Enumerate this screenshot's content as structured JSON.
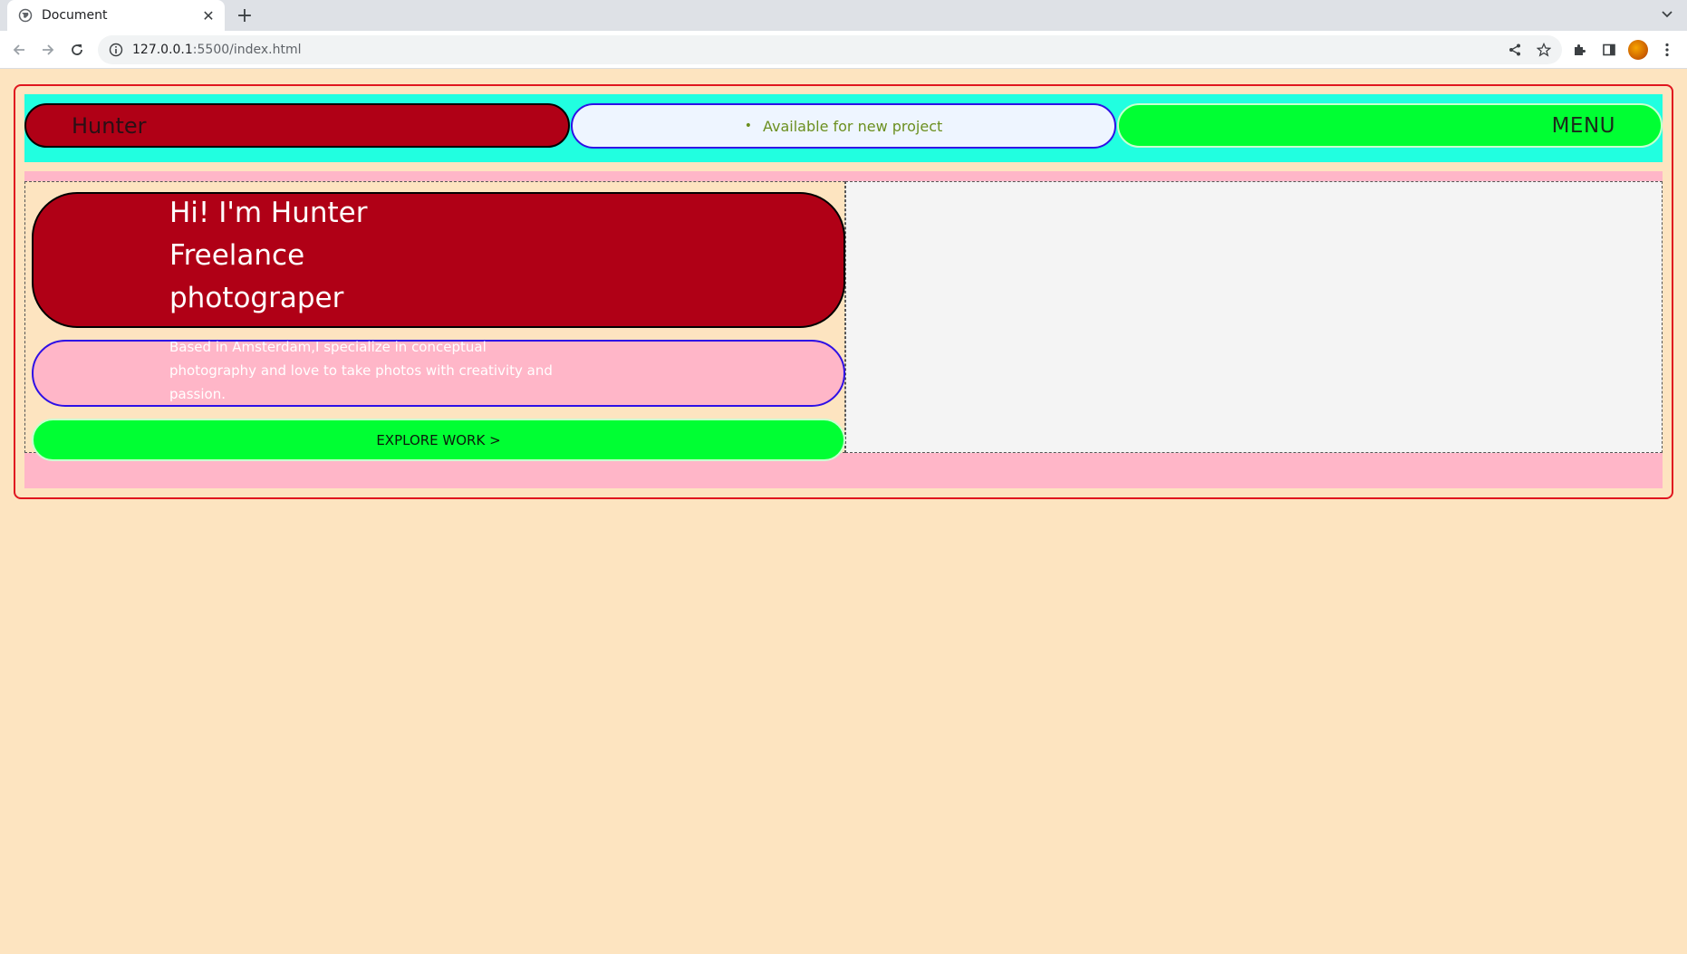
{
  "browser": {
    "tab_title": "Document",
    "tab_close": "✕",
    "new_tab": "+",
    "url_host": "127.0.0.1",
    "url_path": ":5500/index.html"
  },
  "header": {
    "logo": "Hunter",
    "availability": "Available for new project",
    "availability_bullet": "•",
    "menu": "MENU"
  },
  "hero": {
    "title": "Hi! I'm Hunter Freelance photograper",
    "description": "Based in Amsterdam,I specialize in conceptual photography and love to take photos with creativity and passion.",
    "cta": "EXPLORE WORK >"
  },
  "colors": {
    "page_bg": "#fde4c0",
    "header_bg": "#21ffe0",
    "red_pill": "#b00016",
    "green_pill": "#00ff33",
    "pink_bg": "#ffb6c8",
    "outline_red": "#e0161f",
    "outline_blue": "#2e10e6"
  },
  "icons": [
    "globe-icon",
    "close-icon",
    "plus-icon",
    "chevron-down-icon",
    "back-arrow-icon",
    "forward-arrow-icon",
    "reload-icon",
    "info-icon",
    "share-icon",
    "star-icon",
    "extensions-icon",
    "side-panel-icon",
    "kebab-menu-icon"
  ]
}
